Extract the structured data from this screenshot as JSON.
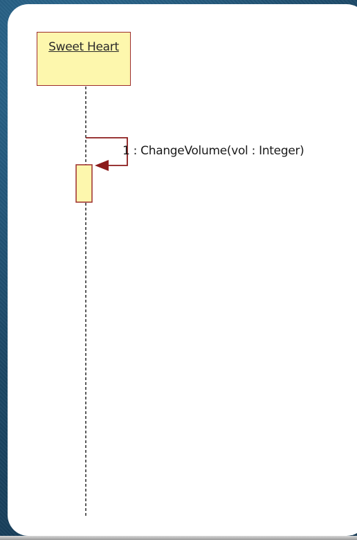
{
  "lifelines": [
    {
      "name": "Sweet Heart"
    }
  ],
  "messages": [
    {
      "number": "1",
      "label": "1 : ChangeVolume(vol : Integer)",
      "type": "self-call"
    }
  ],
  "colors": {
    "background": "#1f4f6f",
    "canvas": "#ffffff",
    "lifeline_fill": "#fdf7ad",
    "lifeline_border": "#9c2b2b",
    "message_arrow": "#8b1a1a",
    "lifeline_dash": "#333333"
  }
}
